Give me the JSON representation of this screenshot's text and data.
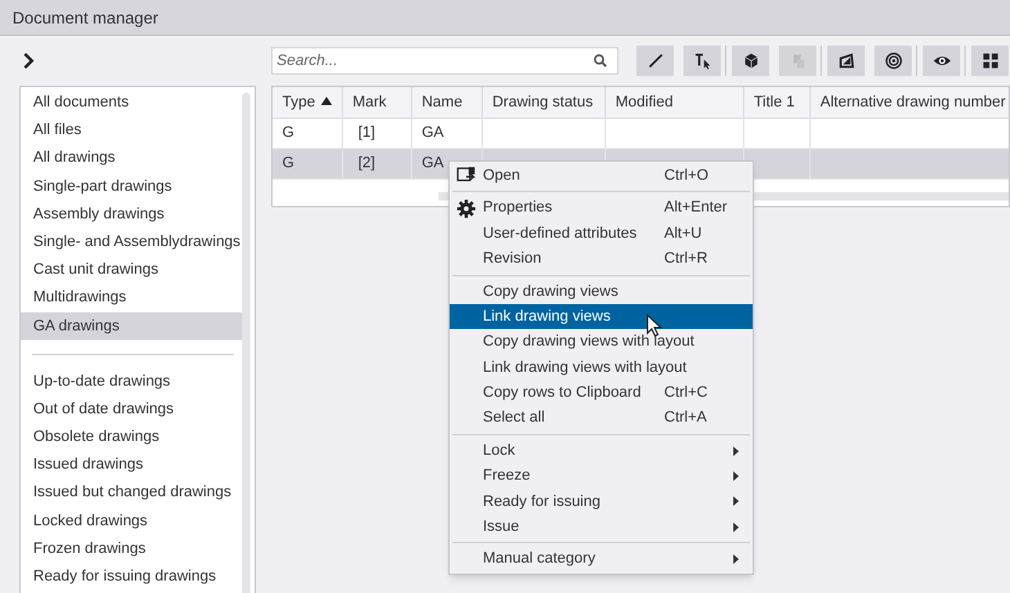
{
  "window": {
    "title": "Document manager"
  },
  "search": {
    "placeholder": "Search..."
  },
  "toolbar": [
    {
      "disabled": false
    },
    {
      "disabled": false
    },
    {
      "disabled": false
    },
    {
      "disabled": true
    },
    {
      "disabled": false
    },
    {
      "disabled": false
    },
    {
      "disabled": false
    },
    {
      "disabled": false
    }
  ],
  "sidebar": {
    "groups": [
      [
        {
          "label": "All documents",
          "selected": false
        },
        {
          "label": "All files",
          "selected": false
        },
        {
          "label": "All drawings",
          "selected": false
        },
        {
          "label": "Single-part drawings",
          "selected": false
        },
        {
          "label": "Assembly drawings",
          "selected": false
        },
        {
          "label": "Single- and Assemblydrawings",
          "selected": false
        },
        {
          "label": "Cast unit drawings",
          "selected": false
        },
        {
          "label": "Multidrawings",
          "selected": false
        },
        {
          "label": "GA drawings",
          "selected": true
        }
      ],
      [
        {
          "label": "Up-to-date drawings",
          "selected": false
        },
        {
          "label": "Out of date drawings",
          "selected": false
        },
        {
          "label": "Obsolete drawings",
          "selected": false
        },
        {
          "label": "Issued drawings",
          "selected": false
        },
        {
          "label": "Issued but changed drawings",
          "selected": false
        },
        {
          "label": "Locked drawings",
          "selected": false
        },
        {
          "label": "Frozen drawings",
          "selected": false
        },
        {
          "label": "Ready for issuing drawings",
          "selected": false
        }
      ]
    ]
  },
  "table": {
    "columns": [
      {
        "label": "Type",
        "sorted": true
      },
      {
        "label": "Mark",
        "sorted": false
      },
      {
        "label": "Name",
        "sorted": false
      },
      {
        "label": "Drawing status",
        "sorted": false
      },
      {
        "label": "Modified",
        "sorted": false
      },
      {
        "label": "Title 1",
        "sorted": false
      },
      {
        "label": "Alternative drawing number",
        "sorted": false
      }
    ],
    "rows": [
      {
        "cells": [
          "G",
          "[1]",
          "GA"
        ],
        "selected": false
      },
      {
        "cells": [
          "G",
          "[2]",
          "GA"
        ],
        "selected": true
      }
    ]
  },
  "context_menu": {
    "groups": [
      [
        {
          "label": "Open",
          "shortcut": "Ctrl+O",
          "submenu": false,
          "selected": false
        }
      ],
      [
        {
          "label": "Properties",
          "shortcut": "Alt+Enter",
          "submenu": false,
          "selected": false
        },
        {
          "label": "User-defined attributes",
          "shortcut": "Alt+U",
          "submenu": false,
          "selected": false
        },
        {
          "label": "Revision",
          "shortcut": "Ctrl+R",
          "submenu": false,
          "selected": false
        }
      ],
      [
        {
          "label": "Copy drawing views",
          "submenu": false,
          "selected": false
        },
        {
          "label": "Link drawing views",
          "submenu": false,
          "selected": true
        },
        {
          "label": "Copy drawing views with layout",
          "submenu": false,
          "selected": false
        },
        {
          "label": "Link drawing views with layout",
          "submenu": false,
          "selected": false
        },
        {
          "label": "Copy rows to Clipboard",
          "shortcut": "Ctrl+C",
          "submenu": false,
          "selected": false
        },
        {
          "label": "Select all",
          "shortcut": "Ctrl+A",
          "submenu": false,
          "selected": false
        }
      ],
      [
        {
          "label": "Lock",
          "submenu": true,
          "selected": false
        },
        {
          "label": "Freeze",
          "submenu": true,
          "selected": false
        },
        {
          "label": "Ready for issuing",
          "submenu": true,
          "selected": false
        },
        {
          "label": "Issue",
          "submenu": true,
          "selected": false
        }
      ],
      [
        {
          "label": "Manual category",
          "submenu": true,
          "selected": false
        }
      ]
    ]
  }
}
